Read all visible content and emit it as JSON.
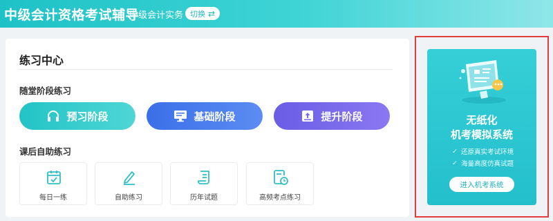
{
  "header": {
    "app_title": "中级会计资格考试辅导",
    "subject": "中级会计实务",
    "switch_label": "切换",
    "switch_icon": "swap-icon"
  },
  "practice_center": {
    "title": "练习中心",
    "in_class": {
      "heading": "随堂阶段练习",
      "buttons": [
        {
          "label": "预习阶段",
          "icon": "headphones-icon",
          "color": "#22c3c6"
        },
        {
          "label": "基础阶段",
          "icon": "monitor-icon",
          "color": "#3a6fe8"
        },
        {
          "label": "提升阶段",
          "icon": "upload-doc-icon",
          "color": "#6a5ee6"
        }
      ]
    },
    "self_study": {
      "heading": "课后自助练习",
      "tiles": [
        {
          "label": "每日一练",
          "icon": "calendar-icon"
        },
        {
          "label": "自助练习",
          "icon": "pencil-icon"
        },
        {
          "label": "历年试题",
          "icon": "scroll-icon"
        },
        {
          "label": "高频考点练习",
          "icon": "clock-doc-icon"
        }
      ]
    }
  },
  "promo": {
    "title_line1": "无纸化",
    "title_line2": "机考模拟系统",
    "features": [
      "还原真实考试环境",
      "海量高度仿真试题"
    ],
    "button_label": "进入机考系统"
  },
  "colors": {
    "accent": "#22c3c6",
    "highlight_border": "#e03c3c"
  }
}
